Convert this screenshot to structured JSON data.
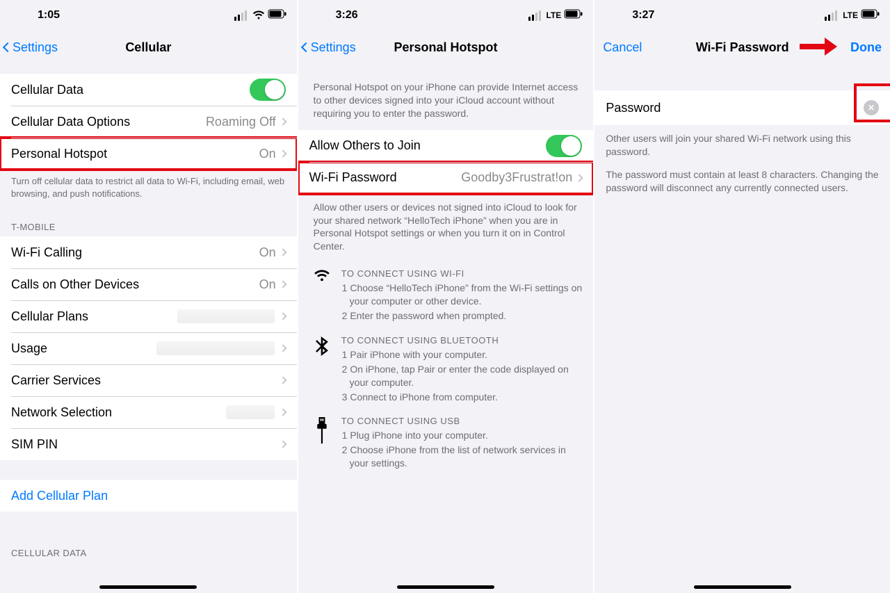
{
  "s1": {
    "time": "1:05",
    "status_icons": "wifi",
    "back": "Settings",
    "title": "Cellular",
    "cellular_data": "Cellular Data",
    "cellular_options": {
      "label": "Cellular Data Options",
      "value": "Roaming Off"
    },
    "hotspot": {
      "label": "Personal Hotspot",
      "value": "On"
    },
    "footer1": "Turn off cellular data to restrict all data to Wi-Fi, including email, web browsing, and push notifications.",
    "carrier_header": "T-MOBILE",
    "wifi_calling": {
      "label": "Wi-Fi Calling",
      "value": "On"
    },
    "calls_other": {
      "label": "Calls on Other Devices",
      "value": "On"
    },
    "cellular_plans": "Cellular Plans",
    "usage": "Usage",
    "carrier_services": "Carrier Services",
    "network_selection": "Network Selection",
    "sim_pin": "SIM PIN",
    "add_plan": "Add Cellular Plan",
    "cellular_data_header": "CELLULAR DATA"
  },
  "s2": {
    "time": "3:26",
    "status_lte": "LTE",
    "back": "Settings",
    "title": "Personal Hotspot",
    "intro": "Personal Hotspot on your iPhone can provide Internet access to other devices signed into your iCloud account without requiring you to enter the password.",
    "allow": "Allow Others to Join",
    "wifi_password": {
      "label": "Wi-Fi Password",
      "value": "Goodby3Frustrat!on"
    },
    "footer2": "Allow other users or devices not signed into iCloud to look for your shared network “HelloTech iPhone” when you are in Personal Hotspot settings or when you turn it on in Control Center.",
    "wifi_block": {
      "title": "TO CONNECT USING WI-FI",
      "step1": "1 Choose “HelloTech iPhone” from the Wi-Fi settings on your computer or other device.",
      "step2": "2 Enter the password when prompted."
    },
    "bt_block": {
      "title": "TO CONNECT USING BLUETOOTH",
      "step1": "1 Pair iPhone with your computer.",
      "step2": "2 On iPhone, tap Pair or enter the code displayed on your computer.",
      "step3": "3 Connect to iPhone from computer."
    },
    "usb_block": {
      "title": "TO CONNECT USING USB",
      "step1": "1 Plug iPhone into your computer.",
      "step2": "2 Choose iPhone from the list of network services in your settings."
    }
  },
  "s3": {
    "time": "3:27",
    "status_lte": "LTE",
    "cancel": "Cancel",
    "title": "Wi-Fi Password",
    "done": "Done",
    "password_label": "Password",
    "footer1": "Other users will join your shared Wi-Fi network using this password.",
    "footer2": "The password must contain at least 8 characters. Changing the password will disconnect any currently connected users."
  }
}
